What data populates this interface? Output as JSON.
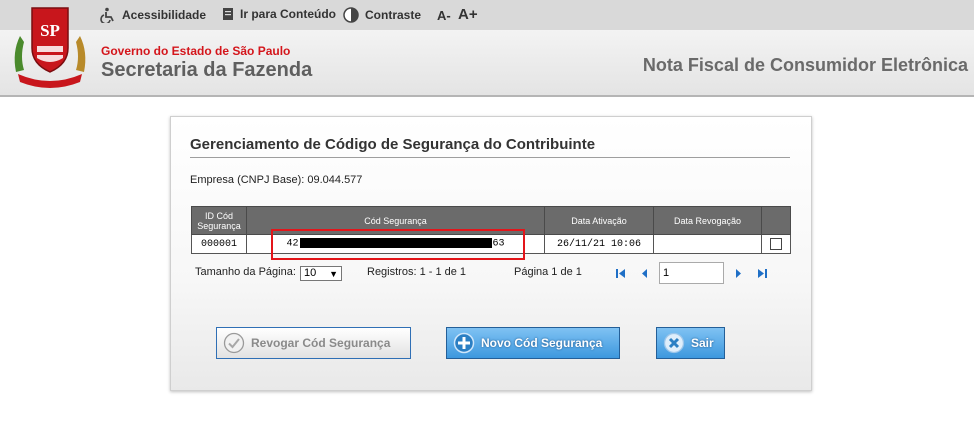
{
  "topbar": {
    "acessibilidade": "Acessibilidade",
    "ir_conteudo": "Ir para Conteúdo",
    "contraste": "Contraste",
    "font_minus": "A-",
    "font_plus": "A+"
  },
  "header": {
    "gov": "Governo do Estado de São Paulo",
    "secretaria": "Secretaria da Fazenda",
    "system": "Nota Fiscal de Consumidor Eletrônica",
    "logo_text": "SP"
  },
  "panel": {
    "title": "Gerenciamento de Código de Segurança do Contribuinte",
    "empresa": "Empresa (CNPJ Base): 09.044.577"
  },
  "table": {
    "headers": {
      "id_line1": "ID Cód",
      "id_line2": "Segurança",
      "cod": "Cód Segurança",
      "ativacao": "Data Ativação",
      "revogacao": "Data Revogação"
    },
    "rows": [
      {
        "id": "000001",
        "cod_prefix": "42",
        "cod_suffix": "63",
        "ativacao": "26/11/21 10:06",
        "revogacao": ""
      }
    ]
  },
  "pager": {
    "tamanho_label": "Tamanho da Página:",
    "tamanho_value": "10",
    "registros": "Registros: 1 - 1 de 1",
    "pagina": "Página 1 de 1",
    "page_input": "1"
  },
  "buttons": {
    "revogar": "Revogar Cód Segurança",
    "novo": "Novo Cód Segurança",
    "sair": "Sair"
  },
  "colors": {
    "highlight": "#e3151a",
    "brand_red": "#d4151b",
    "button_blue": "#3d98de"
  }
}
